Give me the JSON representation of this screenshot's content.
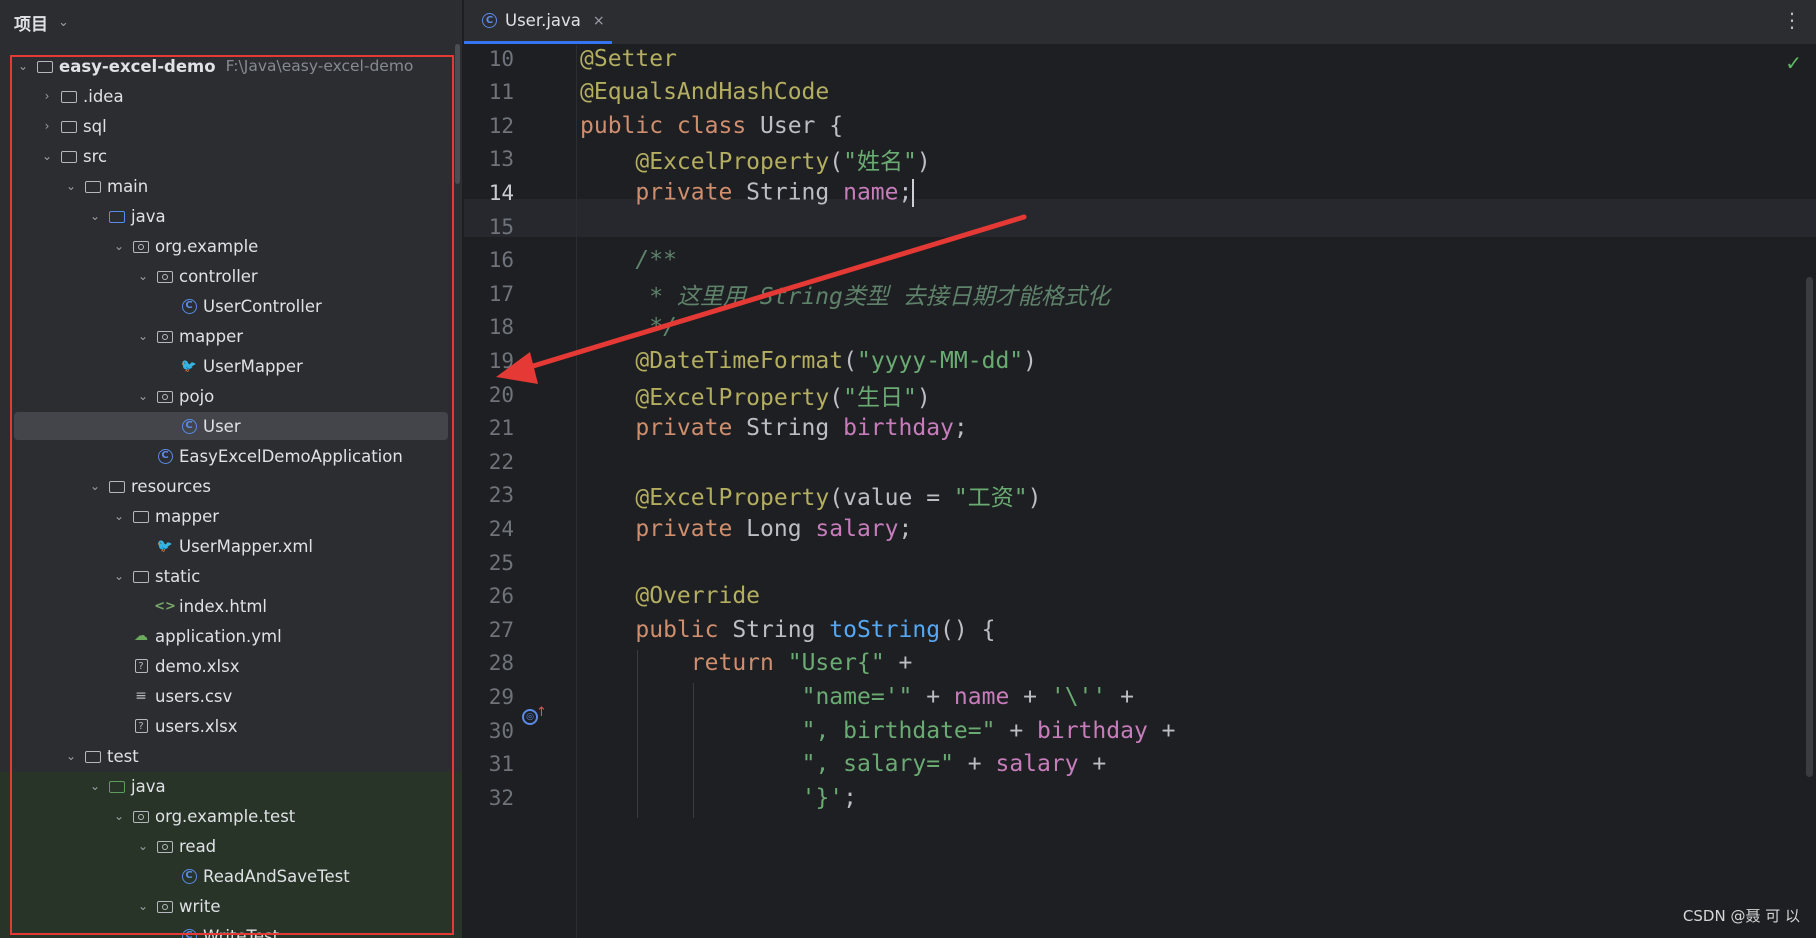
{
  "panel": {
    "title": "项目",
    "project": {
      "name": "easy-excel-demo",
      "path": "F:\\Java\\easy-excel-demo"
    },
    "tree": [
      {
        "label": ".idea",
        "depth": 1,
        "arrow": "›",
        "icon": "folder"
      },
      {
        "label": "sql",
        "depth": 1,
        "arrow": "›",
        "icon": "folder"
      },
      {
        "label": "src",
        "depth": 1,
        "arrow": "⌄",
        "icon": "folder"
      },
      {
        "label": "main",
        "depth": 2,
        "arrow": "⌄",
        "icon": "folder"
      },
      {
        "label": "java",
        "depth": 3,
        "arrow": "⌄",
        "icon": "folder-blue"
      },
      {
        "label": "org.example",
        "depth": 4,
        "arrow": "⌄",
        "icon": "package"
      },
      {
        "label": "controller",
        "depth": 5,
        "arrow": "⌄",
        "icon": "package"
      },
      {
        "label": "UserController",
        "depth": 6,
        "arrow": "",
        "icon": "class"
      },
      {
        "label": "mapper",
        "depth": 5,
        "arrow": "⌄",
        "icon": "package"
      },
      {
        "label": "UserMapper",
        "depth": 6,
        "arrow": "",
        "icon": "mapper"
      },
      {
        "label": "pojo",
        "depth": 5,
        "arrow": "⌄",
        "icon": "package"
      },
      {
        "label": "User",
        "depth": 6,
        "arrow": "",
        "icon": "class",
        "selected": true
      },
      {
        "label": "EasyExcelDemoApplication",
        "depth": 5,
        "arrow": "",
        "icon": "class"
      },
      {
        "label": "resources",
        "depth": 3,
        "arrow": "⌄",
        "icon": "folder"
      },
      {
        "label": "mapper",
        "depth": 4,
        "arrow": "⌄",
        "icon": "folder"
      },
      {
        "label": "UserMapper.xml",
        "depth": 5,
        "arrow": "",
        "icon": "xml"
      },
      {
        "label": "static",
        "depth": 4,
        "arrow": "⌄",
        "icon": "folder"
      },
      {
        "label": "index.html",
        "depth": 5,
        "arrow": "",
        "icon": "html"
      },
      {
        "label": "application.yml",
        "depth": 4,
        "arrow": "",
        "icon": "yml"
      },
      {
        "label": "demo.xlsx",
        "depth": 4,
        "arrow": "",
        "icon": "unknown"
      },
      {
        "label": "users.csv",
        "depth": 4,
        "arrow": "",
        "icon": "csv"
      },
      {
        "label": "users.xlsx",
        "depth": 4,
        "arrow": "",
        "icon": "unknown"
      },
      {
        "label": "test",
        "depth": 2,
        "arrow": "⌄",
        "icon": "folder"
      },
      {
        "label": "java",
        "depth": 3,
        "arrow": "⌄",
        "icon": "folder-green"
      },
      {
        "label": "org.example.test",
        "depth": 4,
        "arrow": "⌄",
        "icon": "package"
      },
      {
        "label": "read",
        "depth": 5,
        "arrow": "⌄",
        "icon": "package"
      },
      {
        "label": "ReadAndSaveTest",
        "depth": 6,
        "arrow": "",
        "icon": "class"
      },
      {
        "label": "write",
        "depth": 5,
        "arrow": "⌄",
        "icon": "package"
      },
      {
        "label": "WriteTest",
        "depth": 6,
        "arrow": "",
        "icon": "class"
      }
    ]
  },
  "tabs": [
    {
      "label": "User.java",
      "close": "×",
      "active": true
    }
  ],
  "editor": {
    "current_line": 14,
    "lines": [
      {
        "n": "10",
        "indent": 0,
        "tokens": [
          [
            "ann",
            "@Setter"
          ]
        ]
      },
      {
        "n": "11",
        "indent": 0,
        "tokens": [
          [
            "ann",
            "@EqualsAndHashCode"
          ]
        ]
      },
      {
        "n": "12",
        "indent": 0,
        "tokens": [
          [
            "kw",
            "public class "
          ],
          [
            "plain",
            "User {"
          ]
        ]
      },
      {
        "n": "13",
        "indent": 1,
        "tokens": [
          [
            "ann",
            "@ExcelProperty"
          ],
          [
            "plain",
            "("
          ],
          [
            "str",
            "\"姓名\""
          ],
          [
            "plain",
            ")"
          ]
        ]
      },
      {
        "n": "14",
        "indent": 1,
        "tokens": [
          [
            "kw",
            "private "
          ],
          [
            "plain",
            "String "
          ],
          [
            "fld",
            "name"
          ],
          [
            "plain",
            ";"
          ]
        ],
        "caret": true
      },
      {
        "n": "15",
        "indent": 0,
        "tokens": []
      },
      {
        "n": "16",
        "indent": 1,
        "tokens": [
          [
            "cmt",
            "/**"
          ]
        ]
      },
      {
        "n": "17",
        "indent": 1,
        "tokens": [
          [
            "cmt",
            " * 这里用 String类型 去接日期才能格式化"
          ]
        ]
      },
      {
        "n": "18",
        "indent": 1,
        "tokens": [
          [
            "cmt",
            " */"
          ]
        ]
      },
      {
        "n": "19",
        "indent": 1,
        "tokens": [
          [
            "ann",
            "@DateTimeFormat"
          ],
          [
            "plain",
            "("
          ],
          [
            "str",
            "\"yyyy-MM-dd\""
          ],
          [
            "plain",
            ")"
          ]
        ]
      },
      {
        "n": "20",
        "indent": 1,
        "tokens": [
          [
            "ann",
            "@ExcelProperty"
          ],
          [
            "plain",
            "("
          ],
          [
            "str",
            "\"生日\""
          ],
          [
            "plain",
            ")"
          ]
        ]
      },
      {
        "n": "21",
        "indent": 1,
        "tokens": [
          [
            "kw",
            "private "
          ],
          [
            "plain",
            "String "
          ],
          [
            "fld",
            "birthday"
          ],
          [
            "plain",
            ";"
          ]
        ]
      },
      {
        "n": "22",
        "indent": 0,
        "tokens": []
      },
      {
        "n": "23",
        "indent": 1,
        "tokens": [
          [
            "ann",
            "@ExcelProperty"
          ],
          [
            "plain",
            "(value = "
          ],
          [
            "str",
            "\"工资\""
          ],
          [
            "plain",
            ")"
          ]
        ]
      },
      {
        "n": "24",
        "indent": 1,
        "tokens": [
          [
            "kw",
            "private "
          ],
          [
            "plain",
            "Long "
          ],
          [
            "fld",
            "salary"
          ],
          [
            "plain",
            ";"
          ]
        ]
      },
      {
        "n": "25",
        "indent": 0,
        "tokens": []
      },
      {
        "n": "26",
        "indent": 1,
        "tokens": [
          [
            "ann",
            "@Override"
          ]
        ]
      },
      {
        "n": "27",
        "indent": 1,
        "tokens": [
          [
            "kw",
            "public "
          ],
          [
            "plain",
            "String "
          ],
          [
            "fn",
            "toString"
          ],
          [
            "plain",
            "() {"
          ]
        ]
      },
      {
        "n": "28",
        "indent": 2,
        "tokens": [
          [
            "kw",
            "return "
          ],
          [
            "str",
            "\"User{\""
          ],
          [
            "plain",
            " +"
          ]
        ]
      },
      {
        "n": "29",
        "indent": 4,
        "tokens": [
          [
            "str",
            "\"name='\""
          ],
          [
            "plain",
            " + "
          ],
          [
            "fld",
            "name"
          ],
          [
            "plain",
            " + "
          ],
          [
            "str",
            "'\\''"
          ],
          [
            "plain",
            " +"
          ]
        ]
      },
      {
        "n": "30",
        "indent": 4,
        "tokens": [
          [
            "str",
            "\", birthdate=\""
          ],
          [
            "plain",
            " + "
          ],
          [
            "fld",
            "birthday"
          ],
          [
            "plain",
            " +"
          ]
        ]
      },
      {
        "n": "31",
        "indent": 4,
        "tokens": [
          [
            "str",
            "\", salary=\""
          ],
          [
            "plain",
            " + "
          ],
          [
            "fld",
            "salary"
          ],
          [
            "plain",
            " +"
          ]
        ]
      },
      {
        "n": "32",
        "indent": 4,
        "tokens": [
          [
            "str",
            "'}'"
          ],
          [
            "plain",
            ";"
          ]
        ]
      }
    ]
  },
  "icons": {
    "tab_class": "C",
    "override_marker": "override-icon",
    "status": "✓",
    "menu": "⋮"
  },
  "watermark": "CSDN @聂 可 以",
  "colors": {
    "annotation_red": "#e53935",
    "accent_blue": "#3574f0"
  }
}
